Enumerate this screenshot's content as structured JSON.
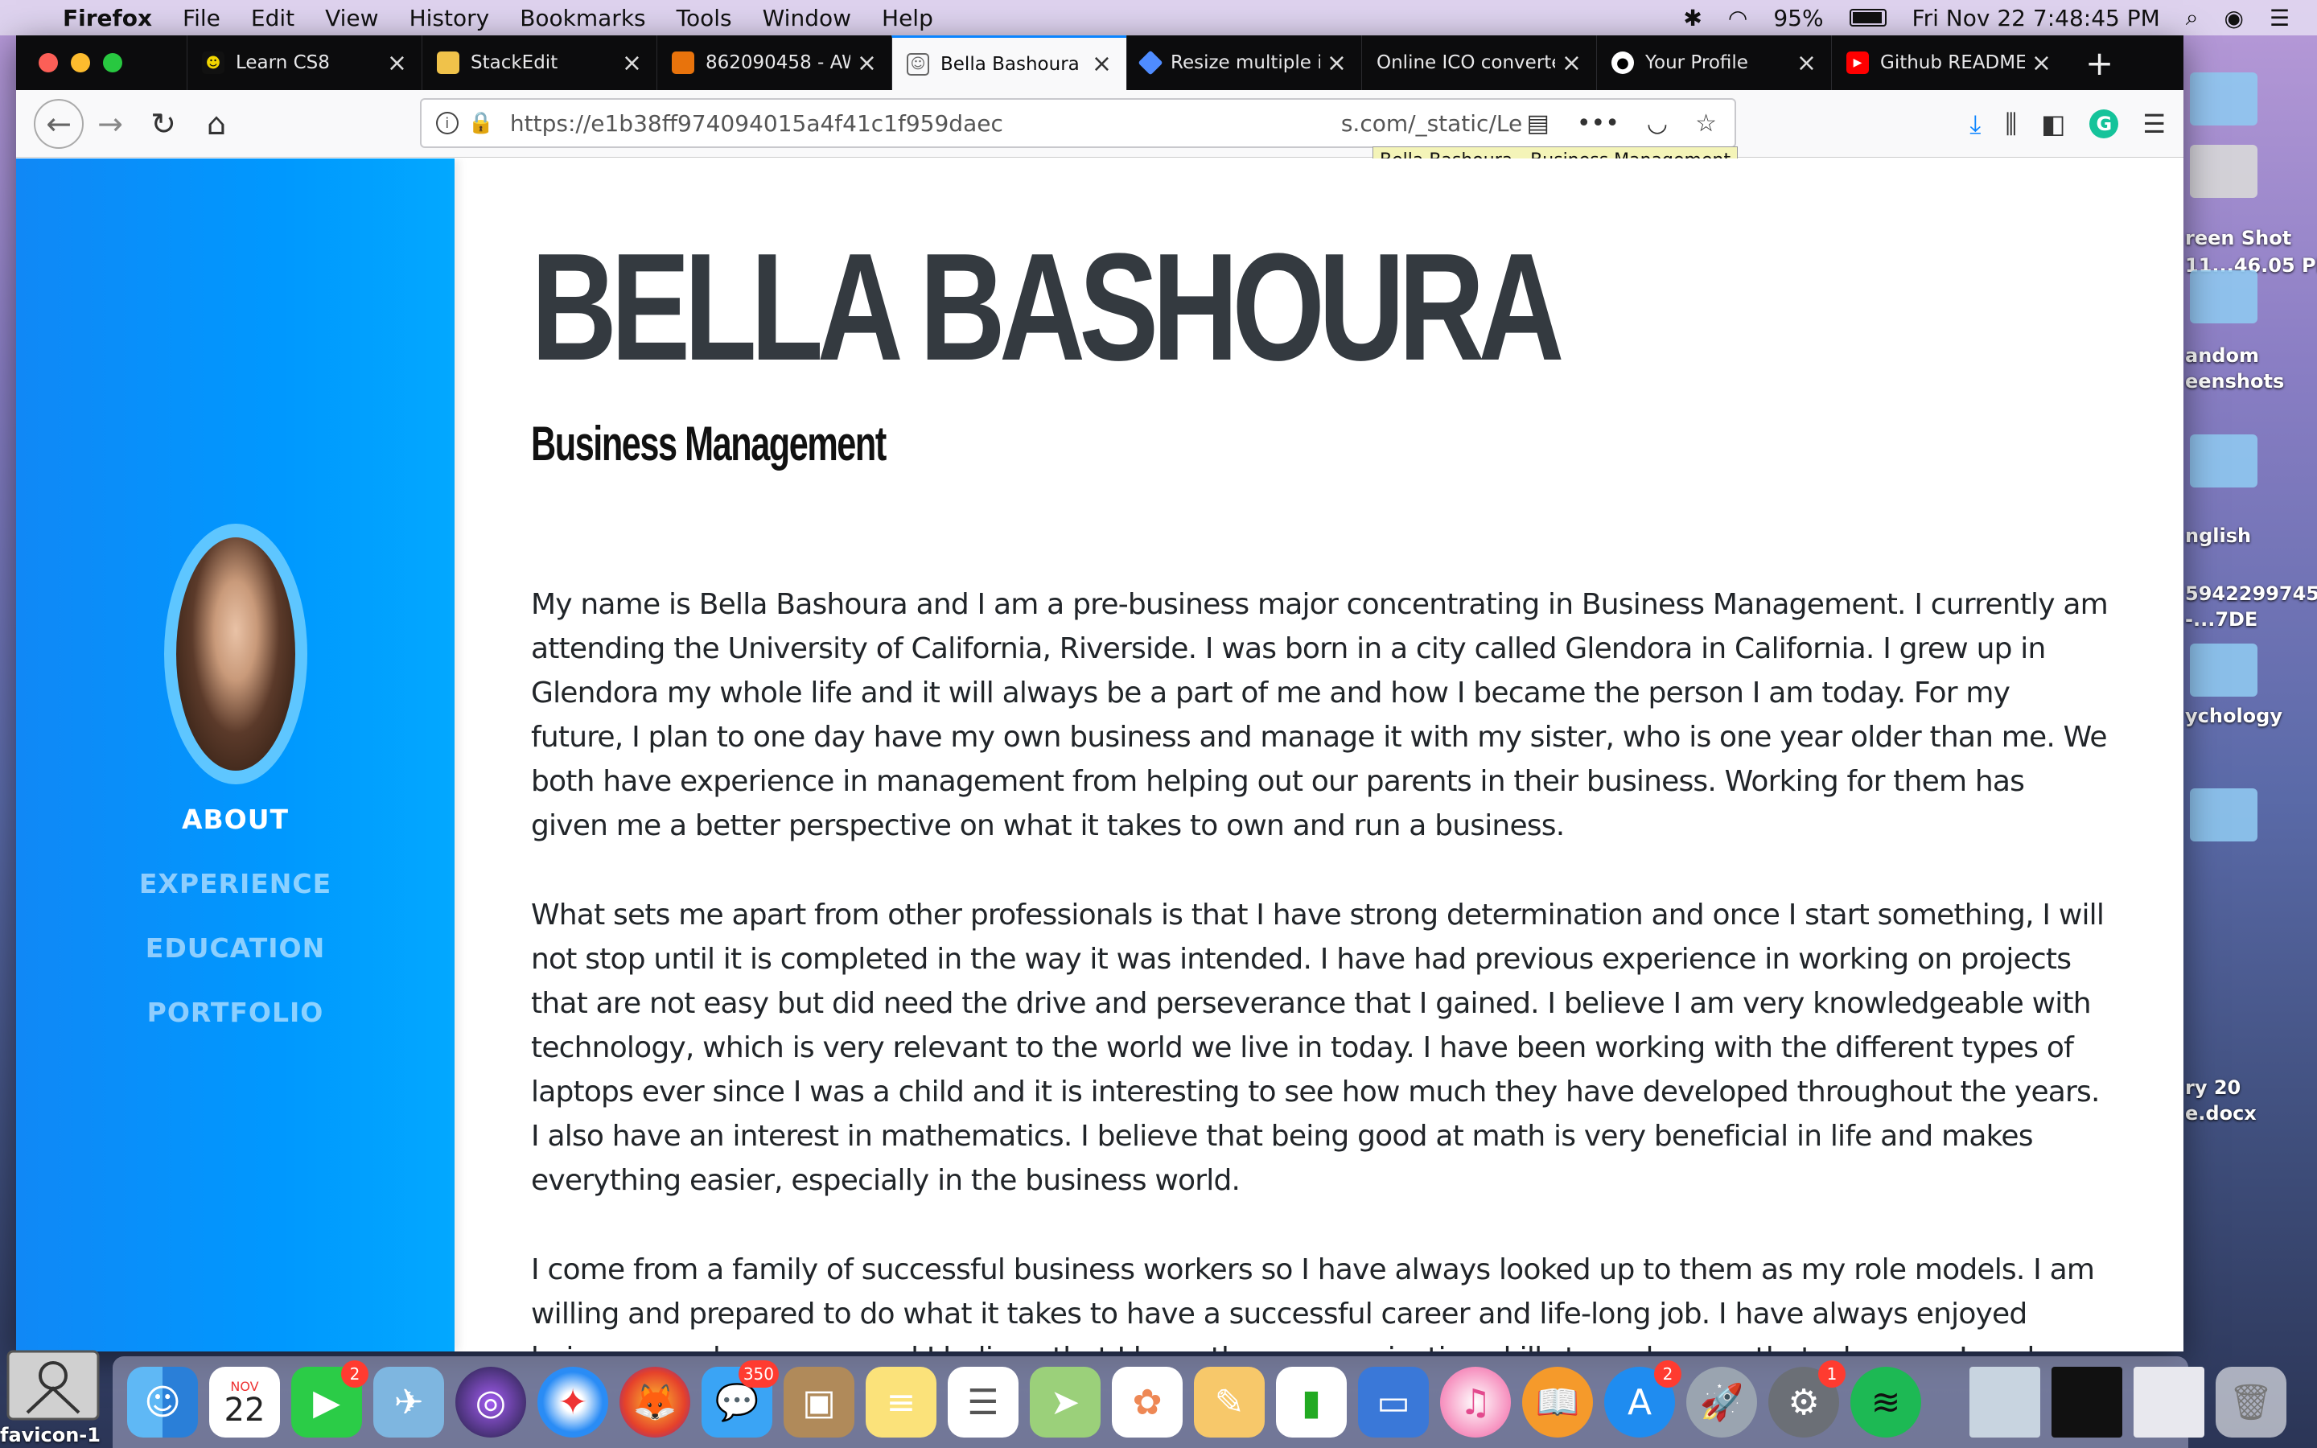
{
  "menubar": {
    "app_name": "Firefox",
    "items": [
      "File",
      "Edit",
      "View",
      "History",
      "Bookmarks",
      "Tools",
      "Window",
      "Help"
    ],
    "battery": "95%",
    "clock": "Fri Nov 22  7:48:45 PM"
  },
  "tabs": [
    {
      "label": "Learn CS8",
      "icon": "cs8-favicon",
      "color": "#000000"
    },
    {
      "label": "StackEdit",
      "icon": "stackedit-favicon",
      "color": "#f0c24a"
    },
    {
      "label": "862090458 - AW",
      "icon": "aws-cube-icon",
      "color": "#e8730c"
    },
    {
      "label": "Bella Bashoura -",
      "icon": "portrait-favicon",
      "color": "#666666"
    },
    {
      "label": "Resize multiple i",
      "icon": "gem-icon",
      "color": "#4f8cff"
    },
    {
      "label": "Online ICO converter",
      "icon": "blank",
      "color": "#0c0c0d"
    },
    {
      "label": "Your Profile",
      "icon": "github-icon",
      "color": "#333333"
    },
    {
      "label": "Github README",
      "icon": "youtube-icon",
      "color": "#ff0000"
    }
  ],
  "address": {
    "url": "https://e1b38ff974094015a4f41c1f959daec",
    "url_tail": "s.com/_static/Le",
    "tooltip": "Bella Bashoura - Business Management"
  },
  "sidebar": {
    "nav": [
      {
        "label": "ABOUT",
        "active": true
      },
      {
        "label": "EXPERIENCE",
        "active": false
      },
      {
        "label": "EDUCATION",
        "active": false
      },
      {
        "label": "PORTFOLIO",
        "active": false
      }
    ]
  },
  "profile": {
    "name": "BELLA BASHOURA",
    "subtitle": "Business Management",
    "paragraphs": [
      "My name is Bella Bashoura and I am a pre-business major concentrating in Business Management. I currently am attending the University of California, Riverside. I was born in a city called Glendora in California. I grew up in Glendora my whole life and it will always be a part of me and how I became the person I am today. For my future, I plan to one day have my own business and manage it with my sister, who is one year older than me. We both have experience in management from helping out our parents in their business. Working for them has given me a better perspective on what it takes to own and run a business.",
      "What sets me apart from other professionals is that I have strong determination and once I start something, I will not stop until it is completed in the way it was intended. I have had previous experience in working on projects that are not easy but did need the drive and perseverance that I gained. I believe I am very knowledgeable with technology, which is very relevant to the world we live in today. I have been working with the different types of laptops ever since I was a child and it is interesting to see how much they have developed throughout the years. I also have an interest in mathematics. I believe that being good at math is very beneficial in life and makes everything easier, especially in the business world.",
      "I come from a family of successful business workers so I have always looked up to them as my role models. I am willing and prepared to do what it takes to have a successful career and life-long job. I have always enjoyed being a peoples-person and I believe that I have the communication skills to make sure that wherever I work, everyone is"
    ]
  },
  "desktop": {
    "items": [
      "reen Shot",
      "11...46.05 PM",
      "andom",
      "eenshots",
      "nglish",
      "5942299745",
      "-...7DE",
      "ychology",
      "ry 20",
      "e.docx"
    ],
    "favicon_label": "favicon-1"
  },
  "dock": {
    "calendar_month": "NOV",
    "calendar_day": "22",
    "badges": {
      "facetime": "2",
      "messages": "350",
      "appstore": "2",
      "sysprefs": "1"
    }
  }
}
